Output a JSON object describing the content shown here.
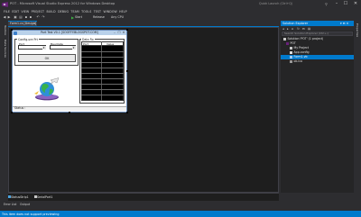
{
  "window": {
    "title": "POT - Microsoft Visual Studio Express 2012 for Windows Desktop",
    "quick_launch_placeholder": "Quick Launch (Ctrl+Q)",
    "controls": {
      "minimize": "–",
      "maximize": "☐",
      "close": "✕"
    }
  },
  "menu": [
    "FILE",
    "EDIT",
    "VIEW",
    "PROJECT",
    "BUILD",
    "DEBUG",
    "TEAM",
    "TOOLS",
    "TEST",
    "WINDOW",
    "HELP"
  ],
  "toolbar": {
    "start_label": "Start",
    "configuration": "Release",
    "platform": "Any CPU"
  },
  "left_rail": {
    "tabs": [
      "Toolbox",
      "Data Sources"
    ]
  },
  "editor": {
    "tab_label": "Form1.cs [Design]",
    "tab_close": "✕"
  },
  "form": {
    "title": "Port Test V0.1 [SOOFFY.BLOGSPOT.COM]",
    "config_group_label": "Config.ure Prt",
    "port_label": "Port",
    "baud_label": "Baudrate",
    "port_value": "",
    "baud_value": "",
    "ok_label": "OK",
    "data_group_label": "Data Rx",
    "grid_columns": [
      "Port",
      "Value"
    ],
    "status_label": "Status :"
  },
  "tray": {
    "components": [
      "StatusStrip1",
      "SerialPort1"
    ]
  },
  "bottom_tabs": [
    "Error List",
    "Output"
  ],
  "solution_explorer": {
    "title": "Solution Explorer",
    "title_buttons": "▾ ⊟ ✕",
    "search_placeholder": "Search Solution Explorer (Ctrl+;)",
    "tree": [
      {
        "label": "Solution 'POT' (1 project)",
        "depth": 0,
        "selected": false
      },
      {
        "label": "POT",
        "depth": 1,
        "selected": false
      },
      {
        "label": "My Project",
        "depth": 2,
        "selected": false
      },
      {
        "label": "App.config",
        "depth": 2,
        "selected": false
      },
      {
        "label": "Form1.vb",
        "depth": 2,
        "selected": true
      },
      {
        "label": "ok.ico",
        "depth": 2,
        "selected": false
      }
    ]
  },
  "right_rail": {
    "tab": "Properties"
  },
  "statusbar": {
    "text": "This item does not support previewing"
  },
  "colors": {
    "accent": "#007acc",
    "ide_bg": "#2d2d30",
    "editor_bg": "#1e1e1e",
    "start_green": "#3cb043"
  }
}
